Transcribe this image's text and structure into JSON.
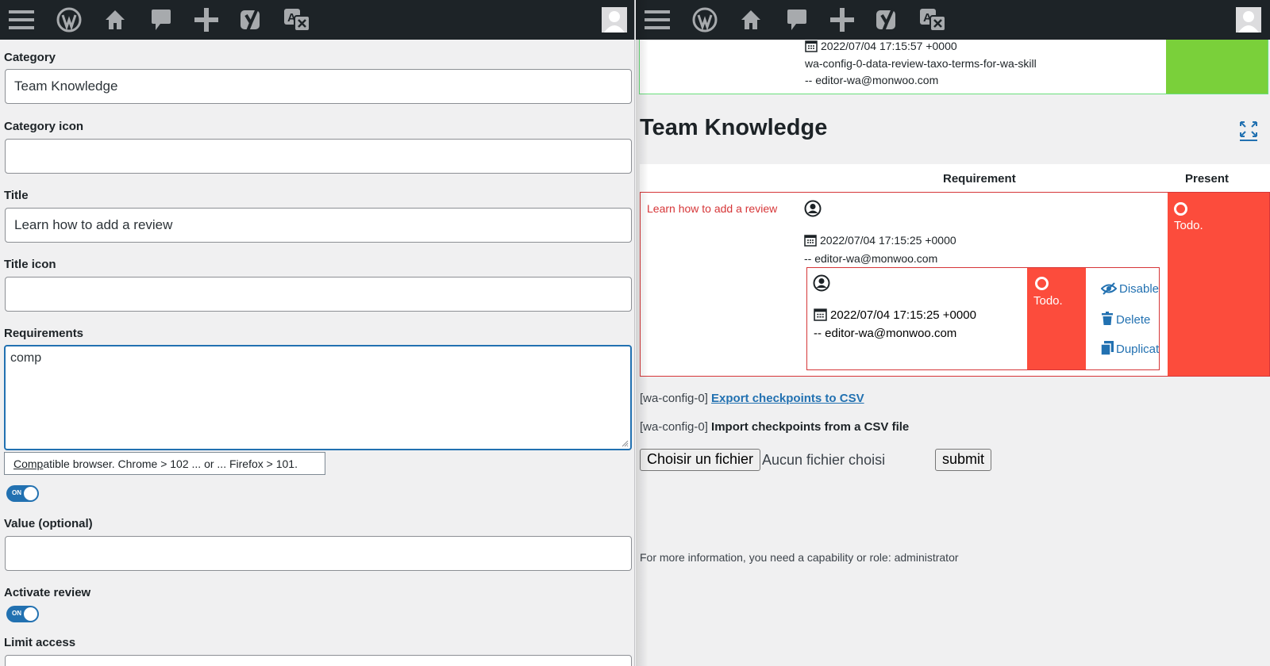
{
  "left": {
    "category": {
      "label": "Category",
      "value": "Team Knowledge"
    },
    "category_icon": {
      "label": "Category icon",
      "value": ""
    },
    "title": {
      "label": "Title",
      "value": "Learn how to add a review"
    },
    "title_icon": {
      "label": "Title icon",
      "value": ""
    },
    "requirements": {
      "label": "Requirements",
      "value": "comp"
    },
    "suggestion": {
      "match": "Comp",
      "rest": "atible browser. Chrome > 102 ... or ... Firefox > 101."
    },
    "result_toggle": {
      "text": "ON",
      "state": true
    },
    "value": {
      "label": "Value (optional)",
      "value": ""
    },
    "activate_review": {
      "label": "Activate review",
      "toggle_text": "ON",
      "state": true
    },
    "limit_access": {
      "label": "Limit access"
    }
  },
  "right": {
    "top_card": {
      "date": "2022/07/04 17:15:57 +0000",
      "slug": "wa-config-0-data-review-taxo-terms-for-wa-skill",
      "author": "-- editor-wa@monwoo.com"
    },
    "heading": "Team Knowledge",
    "table": {
      "col_requirement": "Requirement",
      "col_present": "Present",
      "row": {
        "title": "Learn how to add a review",
        "date": "2022/07/04 17:15:25 +0000",
        "author": "-- editor-wa@monwoo.com",
        "status": "Todo.",
        "inner": {
          "date": "2022/07/04 17:15:25 +0000",
          "author": "-- editor-wa@monwoo.com",
          "status": "Todo.",
          "actions": {
            "disable": "Disable",
            "delete": "Delete",
            "duplicate": "Duplicate"
          }
        }
      }
    },
    "export": {
      "prefix": "[wa-config-0]",
      "link": "Export checkpoints to CSV"
    },
    "import": {
      "prefix": "[wa-config-0]",
      "label": "Import checkpoints from a CSV file"
    },
    "file_button": "Choisir un fichier",
    "file_status": "Aucun fichier choisi",
    "submit": "submit",
    "footer_note": "For more information, you need a capability or role: administrator"
  },
  "colors": {
    "adminbar": "#1d2327",
    "accent": "#2271b1",
    "todo_red": "#fc4c3c",
    "done_green": "#7ad03a"
  },
  "icons": [
    "menu-icon",
    "wordpress-icon",
    "home-icon",
    "comment-icon",
    "plus-icon",
    "yoast-icon",
    "translate-icon",
    "avatar-icon",
    "calendar-icon",
    "user-circle-icon",
    "expand-icon",
    "eye-slash-icon",
    "trash-icon",
    "copy-icon"
  ]
}
